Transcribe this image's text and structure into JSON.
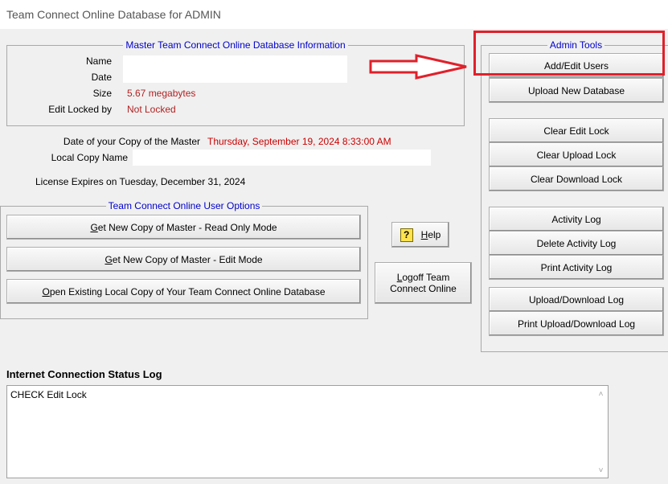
{
  "window": {
    "title": "Team Connect Online Database for ADMIN"
  },
  "master_info": {
    "legend": "Master Team Connect Online Database Information",
    "name_label": "Name",
    "name_value": "",
    "date_label": "Date",
    "date_value": "",
    "size_label": "Size",
    "size_value": "5.67 megabytes",
    "locked_label": "Edit Locked by",
    "locked_value": "Not Locked"
  },
  "local_copy": {
    "date_label": "Date of your Copy of the  Master",
    "date_value": "Thursday, September 19, 2024 8:33:00 AM",
    "name_label": "Local Copy Name",
    "name_value": ""
  },
  "license": {
    "text": "License Expires on  Tuesday, December 31, 2024"
  },
  "user_options": {
    "legend": "Team Connect Online User Options",
    "read_only": {
      "accel": "G",
      "rest": "et New Copy of Master - Read Only Mode"
    },
    "edit_mode": {
      "accel": "G",
      "rest": "et New Copy of Master - Edit Mode"
    },
    "open_local": {
      "accel": "O",
      "rest": "pen Existing Local Copy of Your Team Connect Online Database"
    }
  },
  "help": {
    "accel": "H",
    "rest": "elp",
    "icon": "question-icon"
  },
  "logoff": {
    "accel": "L",
    "line1_rest": "ogoff Team",
    "line2": "Connect Online"
  },
  "admin_tools": {
    "legend": "Admin Tools",
    "add_edit_users": "Add/Edit Users",
    "upload_new_db": "Upload New Database",
    "clear_edit_lock": "Clear Edit Lock",
    "clear_upload_lock": "Clear Upload Lock",
    "clear_download_lock": "Clear Download Lock",
    "activity_log": "Activity Log",
    "delete_activity_log": "Delete Activity Log",
    "print_activity_log": "Print Activity Log",
    "upload_download_log": "Upload/Download Log",
    "print_upload_download_log": "Print Upload/Download Log"
  },
  "status_log": {
    "title": "Internet Connection Status Log",
    "text": "CHECK Edit Lock"
  },
  "colors": {
    "legend": "#0000cc",
    "value_red": "#b22222",
    "annotation_red": "#e0202a"
  }
}
